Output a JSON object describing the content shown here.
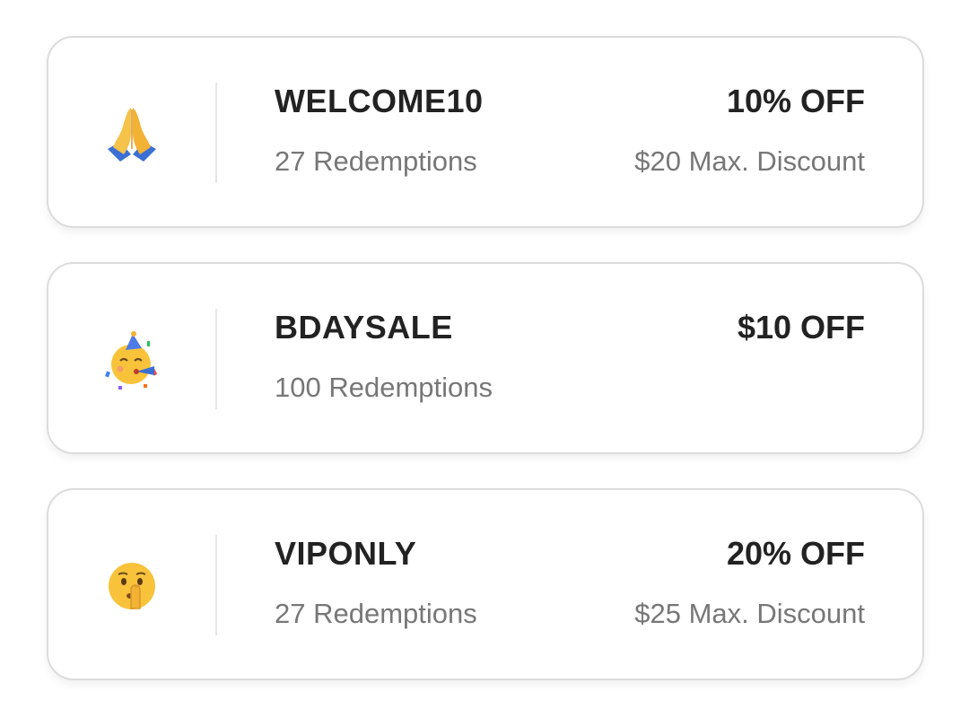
{
  "coupons": [
    {
      "icon": "folded-hands-emoji-icon",
      "code": "WELCOME10",
      "redemptions": "27 Redemptions",
      "discount": "10% OFF",
      "max_discount": "$20 Max. Discount"
    },
    {
      "icon": "partying-face-emoji-icon",
      "code": "BDAYSALE",
      "redemptions": "100 Redemptions",
      "discount": "$10 OFF",
      "max_discount": ""
    },
    {
      "icon": "shushing-face-emoji-icon",
      "code": "VIPONLY",
      "redemptions": "27 Redemptions",
      "discount": "20% OFF",
      "max_discount": "$25 Max. Discount"
    }
  ]
}
